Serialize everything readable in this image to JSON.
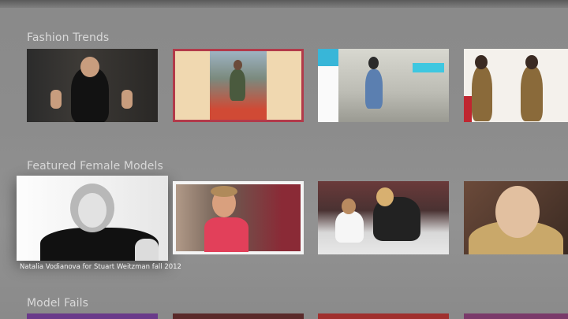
{
  "rows": [
    {
      "title": "Fashion Trends"
    },
    {
      "title": "Featured Female Models",
      "focused_caption": "Natalia Vodianova for Stuart Weitzman fall 2012"
    },
    {
      "title": "Model Fails"
    }
  ]
}
